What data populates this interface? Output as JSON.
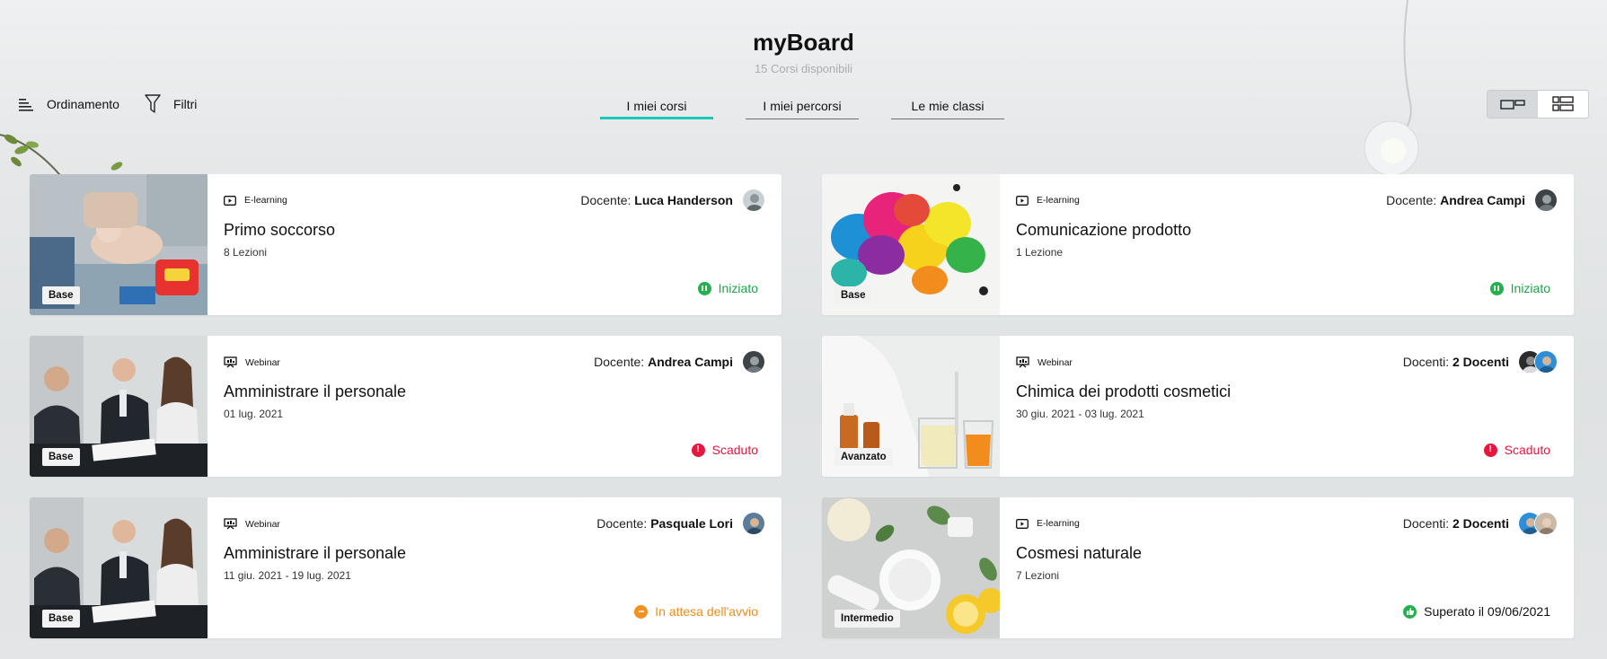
{
  "header": {
    "title": "myBoard",
    "subtitle": "15 Corsi disponibili"
  },
  "toolbar": {
    "sort_label": "Ordinamento",
    "filter_label": "Filtri"
  },
  "tabs": [
    {
      "label": "I miei corsi",
      "active": true
    },
    {
      "label": "I miei percorsi",
      "active": false
    },
    {
      "label": "Le mie classi",
      "active": false
    }
  ],
  "view_toggle": {
    "selected": "cards"
  },
  "courses": [
    {
      "type": "E-learning",
      "type_icon": "video-icon",
      "teacher_label": "Docente:",
      "teacher_name": "Luca Handerson",
      "title": "Primo soccorso",
      "meta": "8 Lezioni",
      "level": "Base",
      "status": "Iniziato",
      "status_kind": "started",
      "thumb_theme": "firstaid",
      "avatar_colors": [
        "#9aa5ad"
      ]
    },
    {
      "type": "E-learning",
      "type_icon": "video-icon",
      "teacher_label": "Docente:",
      "teacher_name": "Andrea Campi",
      "title": "Comunicazione prodotto",
      "meta": "1 Lezione",
      "level": "Base",
      "status": "Iniziato",
      "status_kind": "started",
      "thumb_theme": "bubbles",
      "avatar_colors": [
        "#3d4448"
      ]
    },
    {
      "type": "Webinar",
      "type_icon": "presentation-icon",
      "teacher_label": "Docente:",
      "teacher_name": "Andrea Campi",
      "title": "Amministrare il personale",
      "meta": "01 lug. 2021",
      "level": "Base",
      "status": "Scaduto",
      "status_kind": "expired",
      "thumb_theme": "meeting",
      "avatar_colors": [
        "#3d4448"
      ]
    },
    {
      "type": "Webinar",
      "type_icon": "presentation-icon",
      "teacher_label": "Docenti:",
      "teacher_name": "2 Docenti",
      "title": "Chimica dei prodotti cosmetici",
      "meta": "30 giu. 2021 - 03 lug. 2021",
      "level": "Avanzato",
      "status": "Scaduto",
      "status_kind": "expired",
      "thumb_theme": "chemistry",
      "avatar_colors": [
        "#2b2b2b",
        "#2e8fd8"
      ]
    },
    {
      "type": "Webinar",
      "type_icon": "presentation-icon",
      "teacher_label": "Docente:",
      "teacher_name": "Pasquale Lori",
      "title": "Amministrare il personale",
      "meta": "11 giu. 2021 - 19 lug. 2021",
      "level": "Base",
      "status": "In attesa dell'avvio",
      "status_kind": "waiting",
      "thumb_theme": "meeting",
      "avatar_colors": [
        "#5b7d9a"
      ]
    },
    {
      "type": "E-learning",
      "type_icon": "video-icon",
      "teacher_label": "Docenti:",
      "teacher_name": "2 Docenti",
      "title": "Cosmesi naturale",
      "meta": "7 Lezioni",
      "level": "Intermedio",
      "status": "Superato il 09/06/2021",
      "status_kind": "passed",
      "thumb_theme": "cosmetics",
      "avatar_colors": [
        "#2e8fd8",
        "#c9b9a8"
      ]
    }
  ]
}
